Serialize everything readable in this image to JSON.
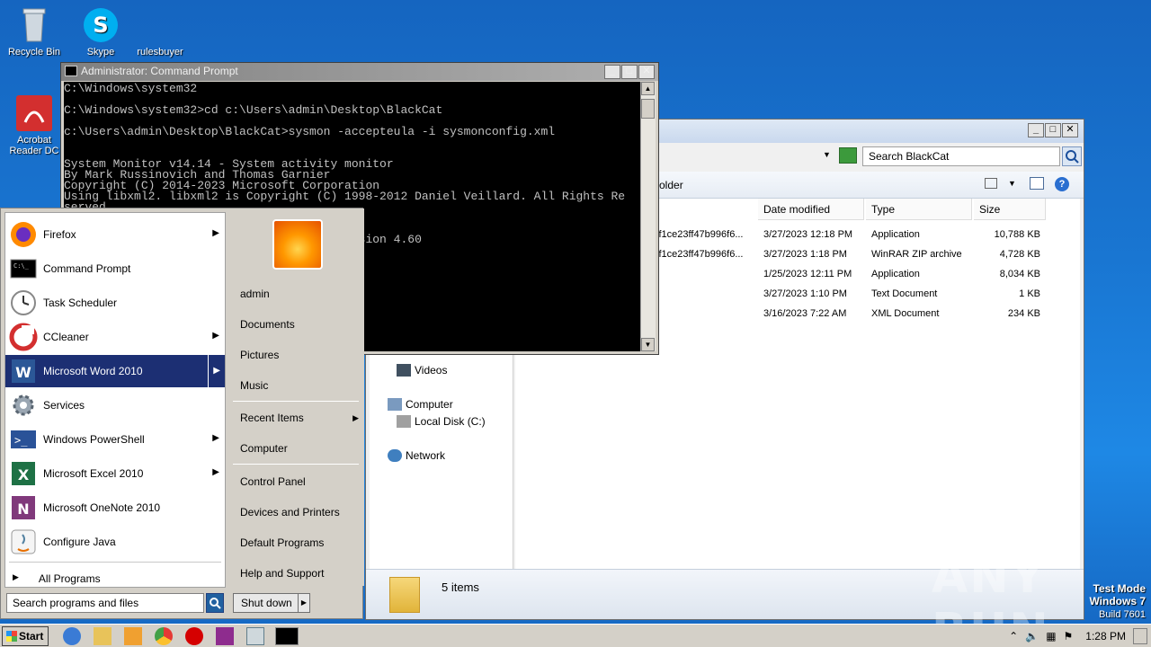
{
  "desktop": {
    "icons": [
      {
        "label": "Recycle Bin"
      },
      {
        "label": "Skype"
      },
      {
        "label": "rulesbuyer"
      },
      {
        "label": "Acrobat Reader DC"
      }
    ],
    "watermark": "ANY RUN",
    "test_mode": {
      "line1": "Test Mode",
      "line2": "Windows 7",
      "line3": "Build 7601"
    }
  },
  "cmd": {
    "title": "Administrator: Command Prompt",
    "lines": [
      "C:\\Windows\\system32",
      "",
      "C:\\Windows\\system32>cd c:\\Users\\admin\\Desktop\\BlackCat",
      "",
      "c:\\Users\\admin\\Desktop\\BlackCat>sysmon -accepteula -i sysmonconfig.xml",
      "",
      "",
      "System Monitor v14.14 - System activity monitor",
      "By Mark Russinovich and Thomas Garnier",
      "Copyright (C) 2014-2023 Microsoft Corporation",
      "Using libxml2. libxml2 is Copyright (C) 1998-2012 Daniel Veillard. All Rights Re",
      "served",
      "",
      "",
      "                                          sion 4.60"
    ]
  },
  "explorer": {
    "search_placeholder": "Search BlackCat",
    "toolbar_folder": "older",
    "columns": {
      "date": "Date modified",
      "type": "Type",
      "size": "Size"
    },
    "files": [
      {
        "name_tail": "cf1ce23ff47b996f6...",
        "date": "3/27/2023 12:18 PM",
        "type": "Application",
        "size": "10,788 KB"
      },
      {
        "name_tail": "cf1ce23ff47b996f6...",
        "date": "3/27/2023 1:18 PM",
        "type": "WinRAR ZIP archive",
        "size": "4,728 KB"
      },
      {
        "name_tail": "",
        "date": "1/25/2023 12:11 PM",
        "type": "Application",
        "size": "8,034 KB"
      },
      {
        "name_tail": "",
        "date": "3/27/2023 1:10 PM",
        "type": "Text Document",
        "size": "1 KB"
      },
      {
        "name_tail": "",
        "date": "3/16/2023 7:22 AM",
        "type": "XML Document",
        "size": "234 KB"
      }
    ],
    "nav": {
      "videos": "Videos",
      "computer": "Computer",
      "local_disk": "Local Disk (C:)",
      "network": "Network"
    },
    "status": "5 items"
  },
  "startmenu": {
    "programs": [
      {
        "label": "Firefox",
        "icon": "firefox-icon"
      },
      {
        "label": "Command Prompt",
        "icon": "cmd-icon"
      },
      {
        "label": "Task Scheduler",
        "icon": "clock-icon"
      },
      {
        "label": "CCleaner",
        "icon": "ccleaner-icon"
      },
      {
        "label": "Microsoft Word 2010",
        "icon": "word-icon"
      },
      {
        "label": "Services",
        "icon": "gear-icon"
      },
      {
        "label": "Windows PowerShell",
        "icon": "powershell-icon"
      },
      {
        "label": "Microsoft Excel 2010",
        "icon": "excel-icon"
      },
      {
        "label": "Microsoft OneNote 2010",
        "icon": "onenote-icon"
      },
      {
        "label": "Configure Java",
        "icon": "java-icon"
      }
    ],
    "all_programs": "All Programs",
    "search_placeholder": "Search programs and files",
    "right_links": {
      "admin": "admin",
      "documents": "Documents",
      "pictures": "Pictures",
      "music": "Music",
      "recent": "Recent Items",
      "computer": "Computer",
      "control_panel": "Control Panel",
      "devices": "Devices and Printers",
      "default_programs": "Default Programs",
      "help": "Help and Support"
    },
    "shutdown": "Shut down"
  },
  "taskbar": {
    "start": "Start",
    "clock": "1:28 PM"
  },
  "colors": {
    "desktop": "#1976d2",
    "selected": "#1c2f73",
    "cmd_bg": "#000000"
  }
}
